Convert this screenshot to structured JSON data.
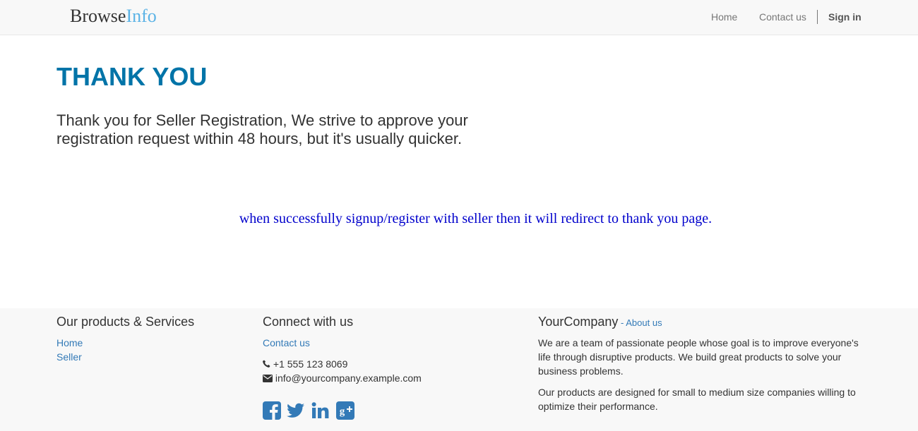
{
  "navbar": {
    "brand_part1": "Browse",
    "brand_part2": "Info",
    "links": {
      "home": "Home",
      "contact": "Contact us",
      "signin": "Sign in"
    }
  },
  "main": {
    "title": "THANK YOU",
    "message": "Thank you for Seller Registration, We strive to approve your registration request within 48 hours, but it's usually quicker.",
    "note": "when successfully signup/register with seller then it will redirect to thank you page."
  },
  "footer": {
    "products": {
      "heading": "Our products & Services",
      "links": [
        "Home",
        "Seller"
      ]
    },
    "connect": {
      "heading": "Connect with us",
      "contact_link": "Contact us",
      "phone": "+1 555 123 8069",
      "email": "info@yourcompany.example.com",
      "social_icons": [
        "facebook-icon",
        "twitter-icon",
        "linkedin-icon",
        "google-plus-icon"
      ]
    },
    "company": {
      "name": "YourCompany",
      "separator": " - ",
      "about_link": "About us",
      "para1": "We are a team of passionate people whose goal is to improve everyone's life through disruptive products. We build great products to solve your business problems.",
      "para2": "Our products are designed for small to medium size companies willing to optimize their performance."
    }
  },
  "colors": {
    "title": "#0074a8",
    "link": "#337ab7",
    "note": "#0000cc",
    "brand_accent": "#5bb3e6"
  }
}
